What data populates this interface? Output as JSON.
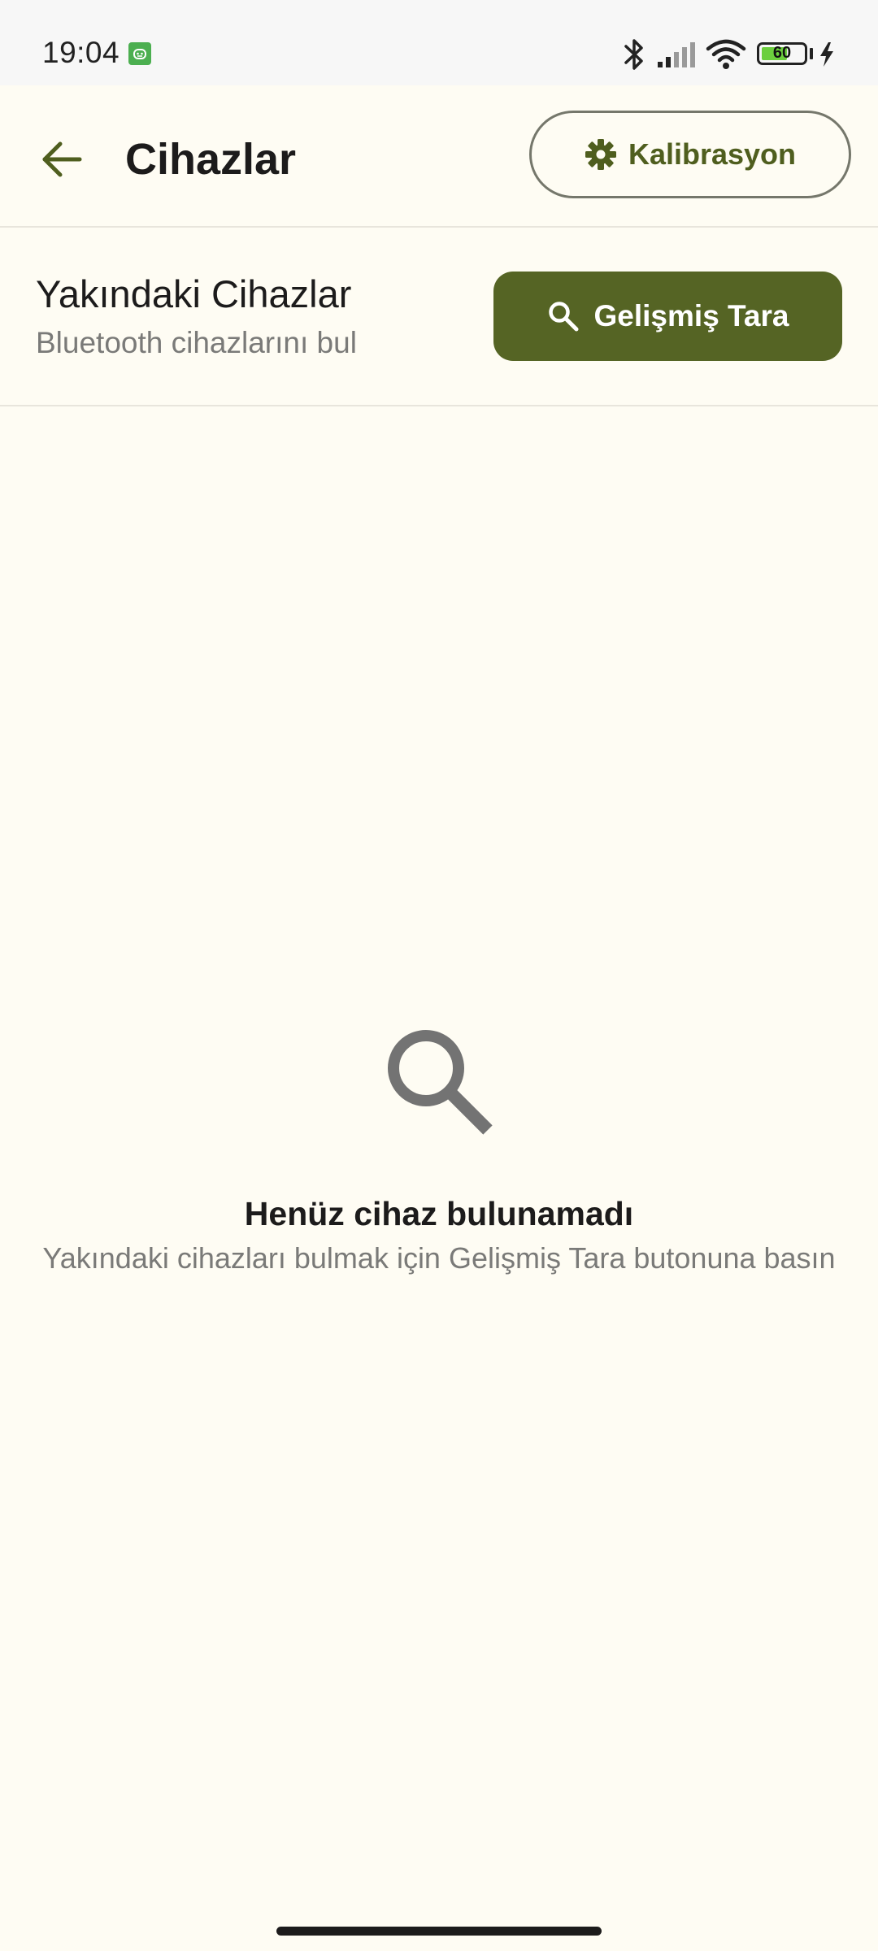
{
  "status_bar": {
    "time": "19:04",
    "battery_level": "60",
    "icons": [
      "bluetooth-icon",
      "signal-icon",
      "wifi-icon",
      "battery-icon",
      "charging-icon"
    ]
  },
  "app_bar": {
    "title": "Cihazlar",
    "back_icon": "arrow-back-icon",
    "calibration_label": "Kalibrasyon",
    "calibration_icon": "gear-icon"
  },
  "nearby": {
    "title": "Yakındaki Cihazlar",
    "subtitle": "Bluetooth cihazlarını bul",
    "scan_label": "Gelişmiş Tara",
    "scan_icon": "search-icon"
  },
  "empty_state": {
    "icon": "search-icon",
    "title": "Henüz cihaz bulunamadı",
    "subtitle": "Yakındaki cihazları bulmak için Gelişmiş Tara butonuna basın"
  },
  "colors": {
    "background": "#fefcf3",
    "accent": "#556424",
    "accent_text": "#4f5e1e",
    "muted_text": "#7a7a78"
  }
}
